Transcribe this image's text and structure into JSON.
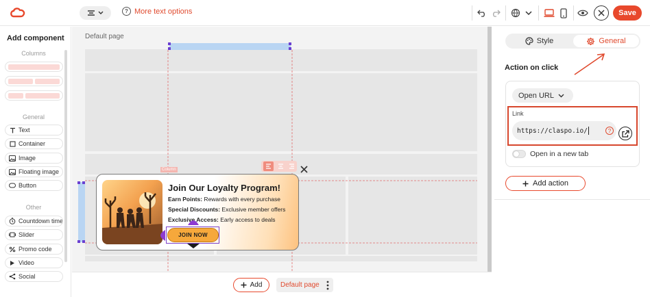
{
  "toolbar": {
    "more_text_options": "More text options",
    "save_label": "Save"
  },
  "left_panel": {
    "title": "Add component",
    "sections": {
      "columns": "Columns",
      "general": "General",
      "other": "Other"
    },
    "general_items": [
      "Text",
      "Container",
      "Image",
      "Floating image",
      "Button"
    ],
    "other_items": [
      "Countdown timer",
      "Slider",
      "Promo code",
      "Video",
      "Social"
    ]
  },
  "canvas": {
    "page_label": "Default page",
    "column_tag": "Column"
  },
  "popup": {
    "title": "Join Our Loyalty Program!",
    "lines": [
      {
        "bold": "Earn Points:",
        "text": " Rewards with every purchase"
      },
      {
        "bold": "Special Discounts:",
        "text": " Exclusive member offers"
      },
      {
        "bold": "Exclusive Access:",
        "text": " Early access to deals"
      }
    ],
    "button": "JOIN NOW"
  },
  "bottom_bar": {
    "add_label": "Add",
    "page_select": "Default page"
  },
  "right_panel": {
    "tabs": {
      "style": "Style",
      "general": "General"
    },
    "active_tab": "General",
    "section_title": "Action on click",
    "action_type": "Open URL",
    "link_label": "Link",
    "link_value": "https://claspo.io/",
    "open_new_tab_label": "Open in a new tab",
    "open_new_tab": false,
    "add_action_label": "Add action"
  },
  "colors": {
    "accent": "#e8482c",
    "join_button": "#f6a83b",
    "column_fill": "#fbd9d6"
  }
}
